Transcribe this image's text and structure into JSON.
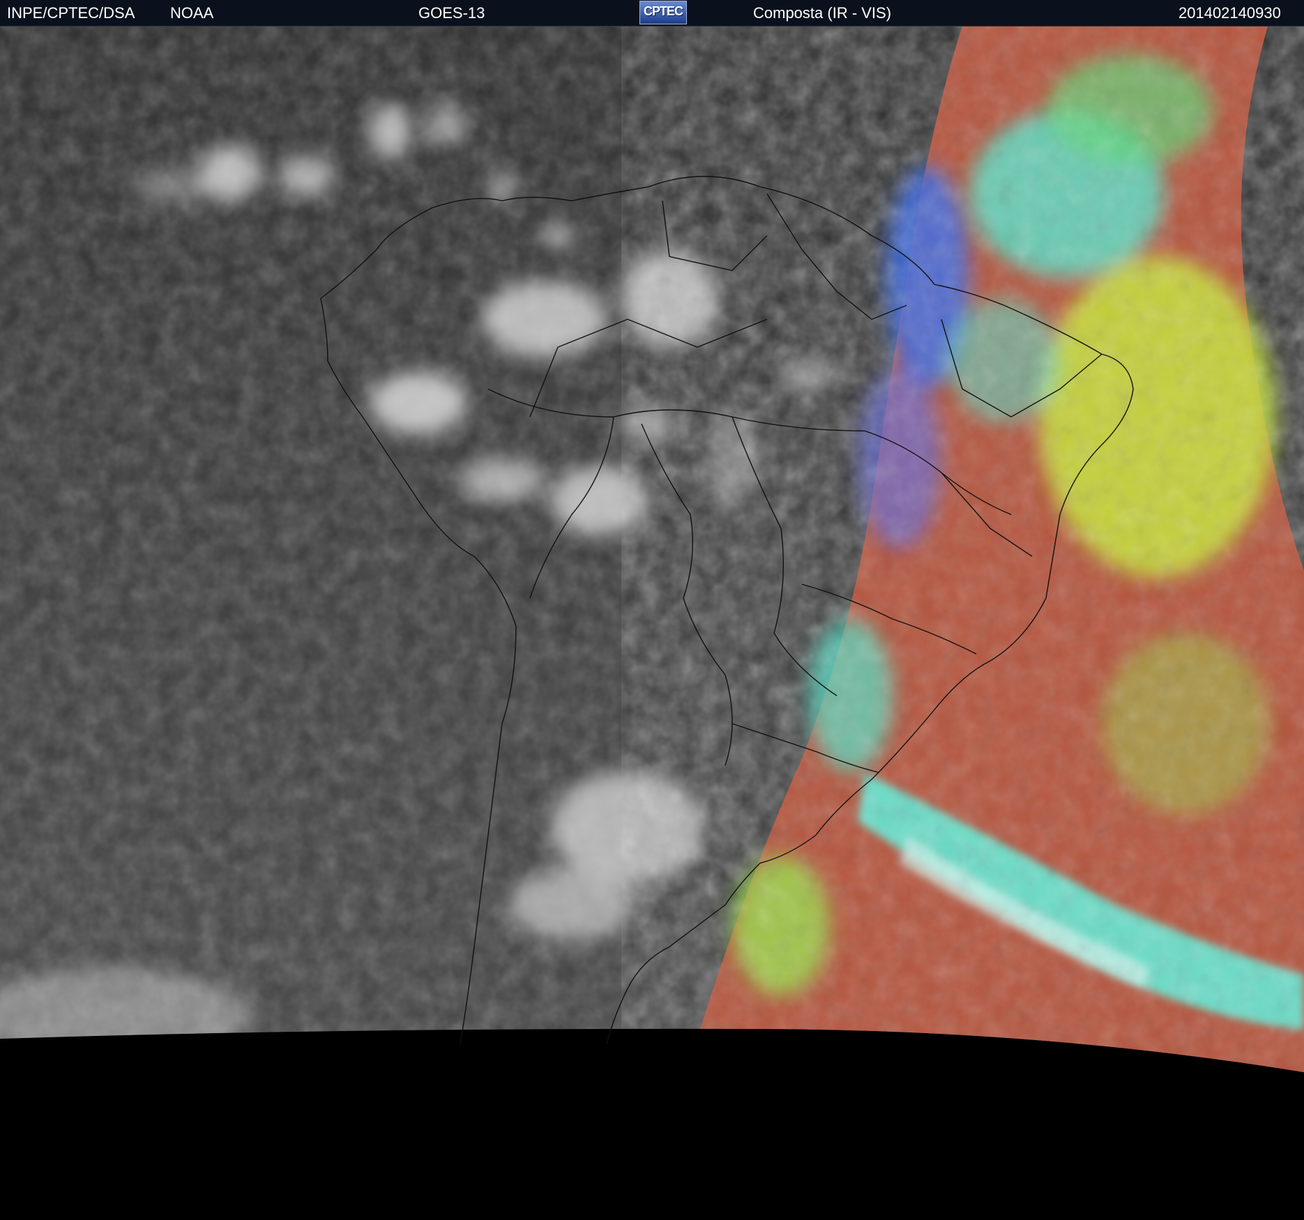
{
  "header": {
    "institution": "INPE/CPTEC/DSA",
    "agency": "NOAA",
    "satellite": "GOES-13",
    "logo_text": "CPTEC",
    "product": "Composta (IR - VIS)",
    "timestamp": "201402140930"
  },
  "colors": {
    "header_bg": "#0b111c",
    "ir_background": "#3a3a3a",
    "space": "#000000",
    "vis_red": "#b5553e",
    "vis_cyan": "#55e8cf",
    "vis_blue": "#3f6fe8",
    "vis_yellow": "#c8e63a"
  }
}
